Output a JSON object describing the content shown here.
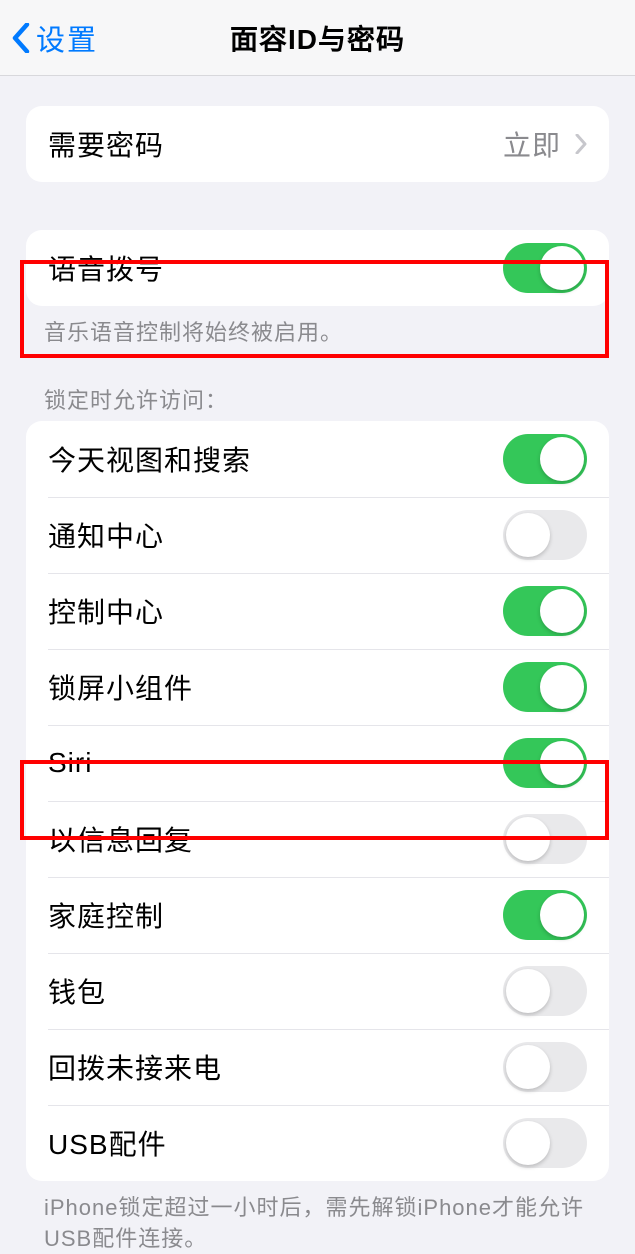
{
  "nav": {
    "back_label": "设置",
    "title": "面容ID与密码"
  },
  "require_passcode": {
    "label": "需要密码",
    "value": "立即"
  },
  "voice_dial": {
    "label": "语音拨号",
    "on": true,
    "footer": "音乐语音控制将始终被启用。"
  },
  "allow_access_header": "锁定时允许访问：",
  "access_items": [
    {
      "label": "今天视图和搜索",
      "on": true
    },
    {
      "label": "通知中心",
      "on": false
    },
    {
      "label": "控制中心",
      "on": true
    },
    {
      "label": "锁屏小组件",
      "on": true
    },
    {
      "label": "Siri",
      "on": true
    },
    {
      "label": "以信息回复",
      "on": false
    },
    {
      "label": "家庭控制",
      "on": true
    },
    {
      "label": "钱包",
      "on": false
    },
    {
      "label": "回拨未接来电",
      "on": false
    },
    {
      "label": "USB配件",
      "on": false
    }
  ],
  "usb_footer": "iPhone锁定超过一小时后，需先解锁iPhone才能允许USB配件连接。"
}
